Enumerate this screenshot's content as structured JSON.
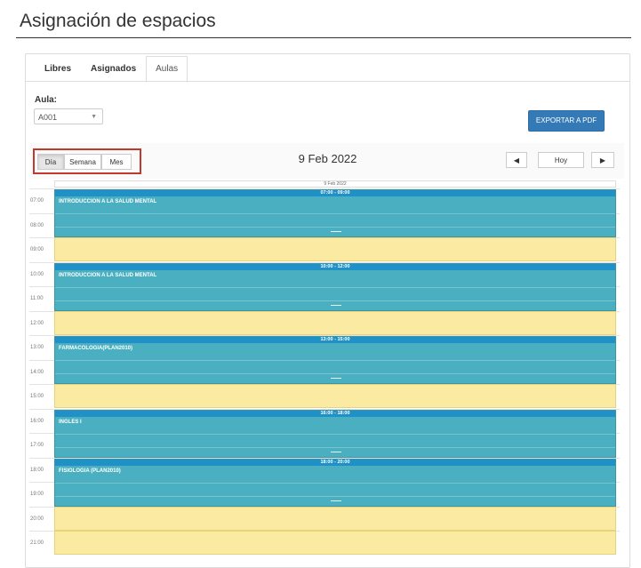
{
  "page": {
    "title": "Asignación de espacios"
  },
  "tabs": [
    {
      "label": "Libres"
    },
    {
      "label": "Asignados"
    },
    {
      "label": "Aulas",
      "active": true
    }
  ],
  "filter": {
    "aula_label": "Aula:",
    "aula_value": "A001"
  },
  "export_button": "EXPORTAR A PDF",
  "view_buttons": {
    "day": "Día",
    "week": "Semana",
    "month": "Mes"
  },
  "calendar": {
    "current_date": "9 Feb 2022",
    "column_header": "9 Feb 2022",
    "nav": {
      "prev_icon": "◀",
      "today": "Hoy",
      "next_icon": "▶"
    },
    "hours": [
      "07:00",
      "08:00",
      "09:00",
      "10:00",
      "11:00",
      "12:00",
      "13:00",
      "14:00",
      "15:00",
      "16:00",
      "17:00",
      "18:00",
      "19:00",
      "20:00",
      "21:00"
    ],
    "events": [
      {
        "time": "07:00 - 09:00",
        "title": "INTRODUCCION A LA SALUD MENTAL"
      },
      {
        "time": "10:00 - 12:00",
        "title": "INTRODUCCION A LA SALUD MENTAL"
      },
      {
        "time": "13:00 - 15:00",
        "title": "FARMACOLOGIA(PLAN2010)"
      },
      {
        "time": "16:00 - 18:00",
        "title": "INGLES I"
      },
      {
        "time": "18:00 - 20:00",
        "title": "FISIOLOGIA (PLAN2010)"
      }
    ]
  },
  "colors": {
    "event_body": "#4ab0c1",
    "event_header": "#1f91c7",
    "free_slot": "#fbeaa2",
    "accent_button": "#337ab7",
    "highlight_border": "#c0392b"
  }
}
